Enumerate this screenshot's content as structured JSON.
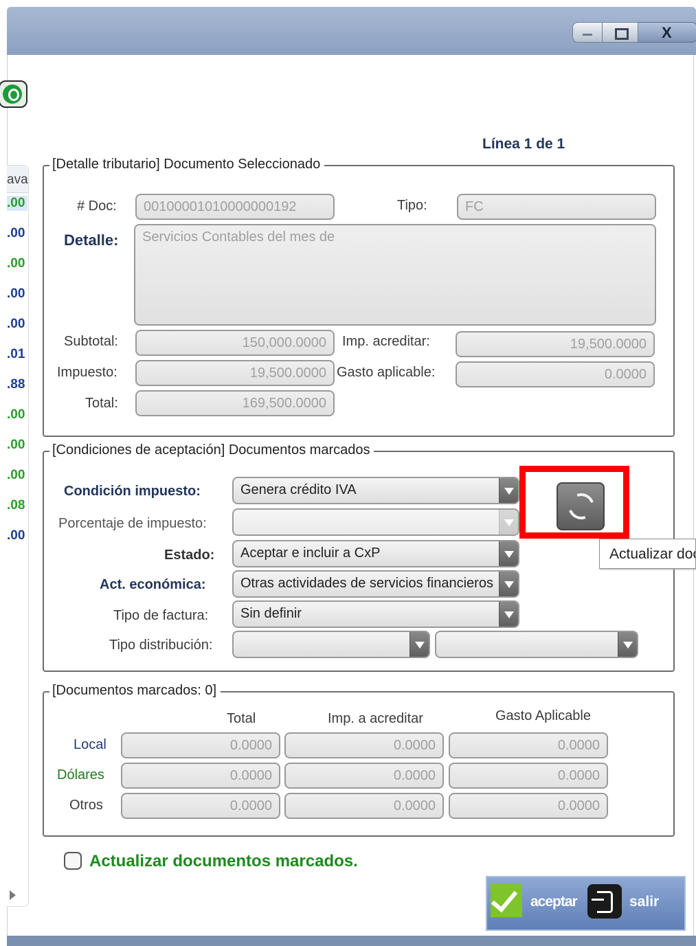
{
  "window": {
    "minimize_icon": "minimize-icon",
    "maximize_icon": "maximize-icon",
    "close_label": "X"
  },
  "left_list": {
    "header": "ava",
    "values": [
      ".00",
      ".00",
      ".00",
      ".00",
      ".00",
      ".01",
      ".88",
      ".00",
      ".00",
      ".00",
      ".08",
      ".00"
    ],
    "value_colors": [
      "#2a9d2a",
      "#1d3f8f",
      "#2a9d2a",
      "#1d3f8f",
      "#1d3f8f",
      "#1d3f8f",
      "#1d3f8f",
      "#2a9d2a",
      "#2a9d2a",
      "#2a9d2a",
      "#2a9d2a",
      "#1d3f8f"
    ]
  },
  "linea": "Línea 1 de 1",
  "detalle": {
    "legend": "[Detalle tributario] Documento Seleccionado",
    "doc_label": "# Doc:",
    "doc_value": "00100001010000000192",
    "tipo_label": "Tipo:",
    "tipo_value": "FC",
    "detalle_label": "Detalle:",
    "detalle_value": "Servicios Contables del mes de",
    "subtotal_label": "Subtotal:",
    "subtotal_value": "150,000.0000",
    "impuesto_label": "Impuesto:",
    "impuesto_value": "19,500.0000",
    "total_label": "Total:",
    "total_value": "169,500.0000",
    "imp_acreditar_label": "Imp. acreditar:",
    "imp_acreditar_value": "19,500.0000",
    "gasto_label": "Gasto aplicable:",
    "gasto_value": "0.0000"
  },
  "condiciones": {
    "legend": "[Condiciones de aceptación] Documentos marcados",
    "condicion_label": "Condición impuesto:",
    "condicion_value": "Genera crédito IVA",
    "porcentaje_label": "Porcentaje de impuesto:",
    "porcentaje_value": "",
    "estado_label": "Estado:",
    "estado_value": "Aceptar e incluir a CxP",
    "actividad_label": "Act. económica:",
    "actividad_value": "Otras actividades de servicios financieros",
    "tipo_factura_label": "Tipo de factura:",
    "tipo_factura_value": "Sin definir",
    "tipo_distribucion_label": "Tipo distribución:",
    "tipo_distribucion_value_1": "",
    "tipo_distribucion_value_2": "",
    "tooltip": "Actualizar documentos"
  },
  "marcados": {
    "legend": "[Documentos marcados: 0]",
    "col_total": "Total",
    "col_imp": "Imp. a acreditar",
    "col_gasto": "Gasto Aplicable",
    "rows": [
      {
        "label": "Local",
        "total": "0.0000",
        "imp": "0.0000",
        "gasto": "0.0000"
      },
      {
        "label": "Dólares",
        "total": "0.0000",
        "imp": "0.0000",
        "gasto": "0.0000"
      },
      {
        "label": "Otros",
        "total": "0.0000",
        "imp": "0.0000",
        "gasto": "0.0000"
      }
    ]
  },
  "actualizar_label": "Actualizar documentos marcados.",
  "actions": {
    "aceptar": "aceptar",
    "salir": "salir"
  }
}
